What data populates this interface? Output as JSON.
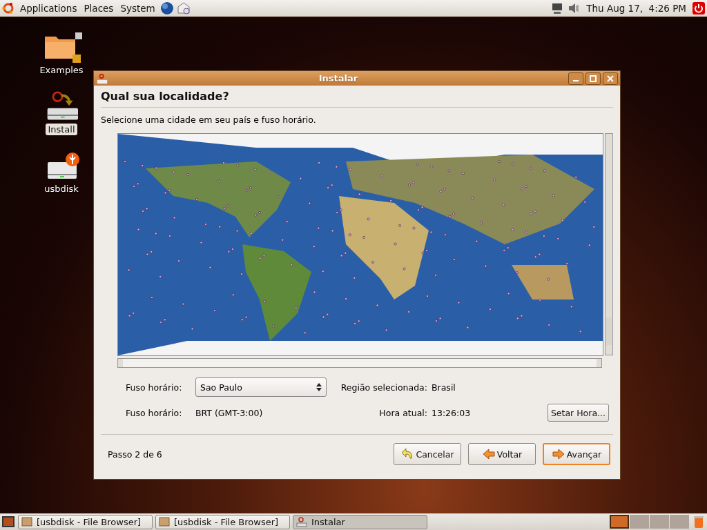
{
  "top_panel": {
    "menus": [
      "Applications",
      "Places",
      "System"
    ],
    "clock": "Thu Aug 17,  4:26 PM"
  },
  "desktop_icons": [
    {
      "label": "Examples",
      "kind": "folder",
      "selected": false
    },
    {
      "label": "Install",
      "kind": "installer",
      "selected": true
    },
    {
      "label": "usbdisk",
      "kind": "usb",
      "selected": false
    }
  ],
  "dialog": {
    "title": "Instalar",
    "heading": "Qual sua localidade?",
    "instruction": "Selecione uma cidade em seu país e fuso horário.",
    "timezone_label": "Fuso horário:",
    "timezone_value": "Sao Paulo",
    "region_label": "Região selecionada:",
    "region_value": "Brasil",
    "zone_label": "Fuso horário:",
    "zone_value": "BRT (GMT-3:00)",
    "time_label": "Hora atual:",
    "time_value": "13:26:03",
    "set_time_button": "Setar Hora...",
    "step": "Passo 2 de 6",
    "buttons": [
      {
        "label": "Cancelar",
        "kind": "cancel",
        "default": false
      },
      {
        "label": "Voltar",
        "kind": "back",
        "default": false
      },
      {
        "label": "Avançar",
        "kind": "forward",
        "default": true
      }
    ]
  },
  "taskbar": {
    "windows": [
      {
        "label": "[usbdisk - File Browser]",
        "kind": "folder",
        "selected": false
      },
      {
        "label": "[usbdisk - File Browser]",
        "kind": "folder",
        "selected": false
      },
      {
        "label": "Instalar",
        "kind": "installer",
        "selected": true
      }
    ],
    "workspaces": [
      {
        "selected": true
      },
      {
        "selected": false
      },
      {
        "selected": false
      },
      {
        "selected": false
      }
    ]
  }
}
